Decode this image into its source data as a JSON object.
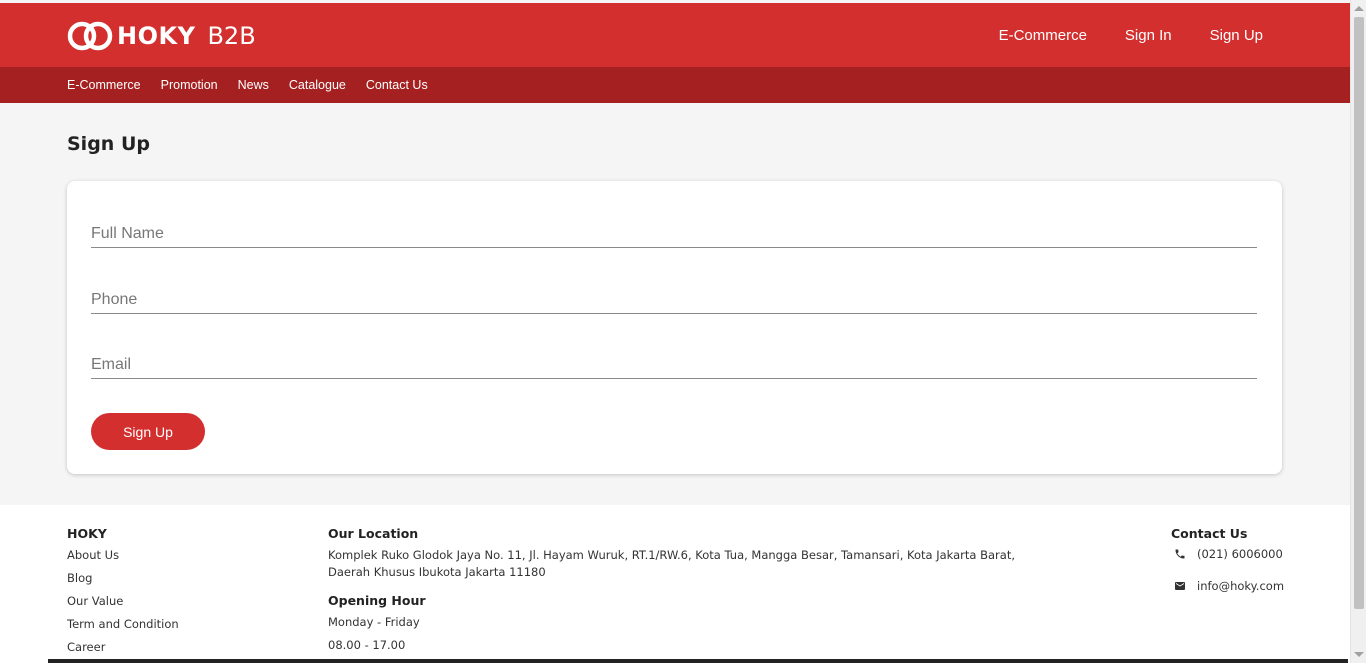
{
  "brand": {
    "name": "HOKY",
    "suffix": "B2B",
    "primary_color": "#d32f2f",
    "secondary_color": "#a52121"
  },
  "top_nav": [
    "E-Commerce",
    "Sign In",
    "Sign Up"
  ],
  "sub_nav": [
    "E-Commerce",
    "Promotion",
    "News",
    "Catalogue",
    "Contact Us"
  ],
  "page_title": "Sign Up",
  "form": {
    "full_name_placeholder": "Full Name",
    "phone_placeholder": "Phone",
    "email_placeholder": "Email",
    "submit_label": "Sign Up"
  },
  "footer": {
    "hoky": {
      "title": "HOKY",
      "links": [
        "About Us",
        "Blog",
        "Our Value",
        "Term and Condition",
        "Career"
      ]
    },
    "location": {
      "title": "Our Location",
      "address_line1": "Komplek Ruko Glodok Jaya No. 11, Jl. Hayam Wuruk, RT.1/RW.6, Kota Tua, Mangga Besar, Tamansari, Kota Jakarta Barat,",
      "address_line2": "Daerah Khusus Ibukota Jakarta 11180",
      "hours_title": "Opening Hour",
      "days": "Monday - Friday",
      "hours": "08.00 - 17.00"
    },
    "contact": {
      "title": "Contact Us",
      "phone": "(021) 6006000",
      "email": "info@hoky.com",
      "phone_icon": "phone-icon",
      "email_icon": "mail-icon"
    }
  }
}
